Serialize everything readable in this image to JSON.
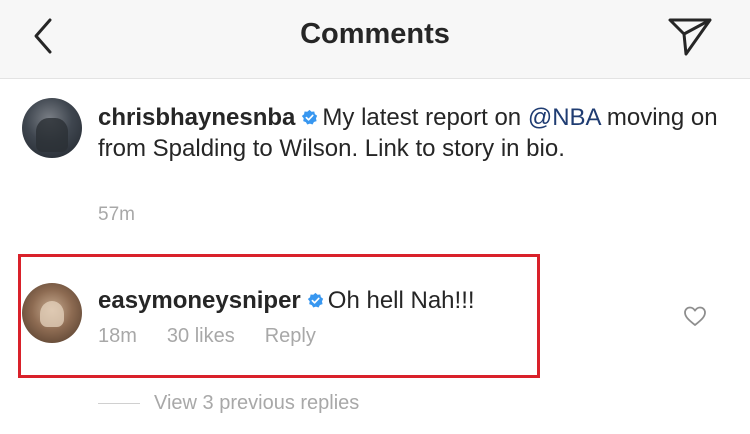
{
  "header": {
    "title": "Comments",
    "back_icon": "chevron-left-icon",
    "share_icon": "paper-plane-icon"
  },
  "post": {
    "username": "chrisbhaynesnba",
    "verified": true,
    "text_before": "My latest report on ",
    "mention": "@NBA",
    "text_after": " moving on from Spalding to Wilson. Link to story in bio.",
    "time": "57m"
  },
  "comment": {
    "username": "easymoneysniper",
    "verified": true,
    "text": "Oh hell Nah!!!",
    "time": "18m",
    "likes": "30 likes",
    "reply_label": "Reply",
    "like_icon": "heart-outline-icon",
    "highlight_color": "#d9212a"
  },
  "replies": {
    "label": "View 3 previous replies"
  },
  "colors": {
    "verified_badge": "#3897f0",
    "mention": "#1f3c72",
    "muted_text": "#a8a8a8"
  }
}
